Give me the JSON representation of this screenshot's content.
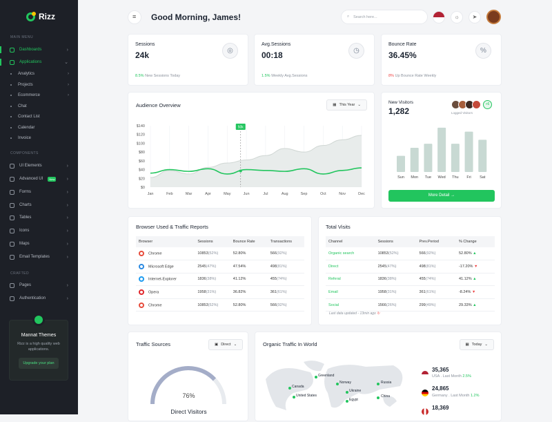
{
  "brand": {
    "name": "Rizz"
  },
  "sidebar": {
    "main_menu": "MAIN MENU",
    "dashboards": "Dashboards",
    "applications": "Applications",
    "app_items": [
      "Analytics",
      "Projects",
      "Ecommerce",
      "Chat",
      "Contact List",
      "Calendar",
      "Invoice"
    ],
    "components": "COMPONENTS",
    "comp_items": [
      "UI Elements",
      "Advanced UI",
      "Forms",
      "Charts",
      "Tables",
      "Icons",
      "Maps",
      "Email Templates"
    ],
    "new_badge": "New",
    "crafted": "CRAFTED",
    "crafted_items": [
      "Pages",
      "Authentication"
    ],
    "promo": {
      "title": "Mannat Themes",
      "text": "Rizz is a high quality web applications.",
      "button": "Upgrade your plan"
    }
  },
  "header": {
    "greeting": "Good Morning, James!",
    "search_placeholder": "Search here..."
  },
  "stats": [
    {
      "label": "Sessions",
      "value": "24k",
      "sub_value": "8.5%",
      "sub_text": "New Sessions Today",
      "sub_color": "#22c55e",
      "icon": "globe-icon"
    },
    {
      "label": "Avg.Sessions",
      "value": "00:18",
      "sub_value": "1.5%",
      "sub_text": "Weekly Avg.Sessions",
      "sub_color": "#22c55e",
      "icon": "clock-icon"
    },
    {
      "label": "Bounce Rate",
      "value": "36.45%",
      "sub_value": "8%",
      "sub_text": "Up Bounce Rate Weekly",
      "sub_color": "#ef4444",
      "icon": "percent-icon"
    }
  ],
  "audience": {
    "title": "Audience Overview",
    "filter": "This Year"
  },
  "chart_data": [
    {
      "type": "area",
      "title": "Audience Overview",
      "categories": [
        "Jan",
        "Feb",
        "Mar",
        "Apr",
        "May",
        "Jun",
        "Jul",
        "Aug",
        "Sep",
        "Oct",
        "Nov",
        "Dec"
      ],
      "y_ticks": [
        "$140",
        "$120",
        "$100",
        "$80",
        "$60",
        "$40",
        "$20",
        "$0"
      ],
      "ylim": [
        0,
        140
      ],
      "annotation": "50k",
      "series": [
        {
          "values": [
            22,
            38,
            30,
            45,
            55,
            62,
            72,
            88,
            80,
            95,
            108,
            118
          ]
        },
        {
          "values": [
            32,
            40,
            36,
            42,
            30,
            40,
            38,
            36,
            42,
            30,
            38,
            44
          ]
        }
      ],
      "grid": true
    },
    {
      "type": "bar",
      "title": "New Visitors",
      "categories": [
        "Sun",
        "Mon",
        "Tue",
        "Wed",
        "Thu",
        "Fri",
        "Sat"
      ],
      "values": [
        4,
        6,
        7,
        11,
        7,
        10,
        8
      ]
    }
  ],
  "visitors": {
    "title": "New Visitors",
    "value": "1,282",
    "logged": "Logged Visitors",
    "more": "+6",
    "button": "More Detail →"
  },
  "browser": {
    "title": "Browser Used & Traffic Reports",
    "headers": [
      "Browser",
      "Sessions",
      "Bounce Rate",
      "Transactions"
    ],
    "rows": [
      {
        "name": "Chrome",
        "sessions": "10853",
        "s_pct": "(52%)",
        "bounce": "52.80%",
        "tx": "566",
        "tx_pct": "(92%)",
        "color": "#e74c3c"
      },
      {
        "name": "Microsoft Edge",
        "sessions": "2545",
        "s_pct": "(47%)",
        "bounce": "47.54%",
        "tx": "498",
        "tx_pct": "(81%)",
        "color": "#2b8ae2"
      },
      {
        "name": "Internet-Explorer",
        "sessions": "1836",
        "s_pct": "(38%)",
        "bounce": "41.12%",
        "tx": "455",
        "tx_pct": "(74%)",
        "color": "#1d9bf0"
      },
      {
        "name": "Opera",
        "sessions": "1958",
        "s_pct": "(31%)",
        "bounce": "36.82%",
        "tx": "361",
        "tx_pct": "(61%)",
        "color": "#e0262b"
      },
      {
        "name": "Chrome",
        "sessions": "10853",
        "s_pct": "(52%)",
        "bounce": "52.80%",
        "tx": "566",
        "tx_pct": "(92%)",
        "color": "#e74c3c"
      }
    ]
  },
  "visits": {
    "title": "Total Visits",
    "headers": [
      "Channel",
      "Sessions",
      "Prev.Period",
      "% Change"
    ],
    "rows": [
      {
        "channel": "Organic search",
        "sessions": "10853",
        "s_pct": "(52%)",
        "prev": "566",
        "p_pct": "(92%)",
        "change": "52.80%",
        "dir": "up"
      },
      {
        "channel": "Direct",
        "sessions": "2545",
        "s_pct": "(47%)",
        "prev": "498",
        "p_pct": "(81%)",
        "change": "-17.20%",
        "dir": "down"
      },
      {
        "channel": "Referal",
        "sessions": "1836",
        "s_pct": "(38%)",
        "prev": "455",
        "p_pct": "(74%)",
        "change": "41.12%",
        "dir": "up"
      },
      {
        "channel": "Email",
        "sessions": "1958",
        "s_pct": "(31%)",
        "prev": "361",
        "p_pct": "(61%)",
        "change": "-8.24%",
        "dir": "down"
      },
      {
        "channel": "Social",
        "sessions": "1566",
        "s_pct": "(26%)",
        "prev": "299",
        "p_pct": "(49%)",
        "change": "29.33%",
        "dir": "up"
      }
    ],
    "footer": "Last data updated - 13min ago"
  },
  "sources": {
    "title": "Traffic Sources",
    "filter": "Direct",
    "percent": "76%",
    "label": "Direct Visitors",
    "percent_value": 0.76
  },
  "organic": {
    "title": "Organic Traffic In World",
    "filter": "Today",
    "places": [
      "Greenland",
      "Canada",
      "Norway",
      "Russia",
      "Ukraine",
      "United States",
      "Egypt",
      "China"
    ],
    "countries": [
      {
        "value": "35,365",
        "name": "USA . Last Month",
        "pct": "2.5%",
        "color": "#3b5bdb"
      },
      {
        "value": "24,865",
        "name": "Germany . Last Month",
        "pct": "1.2%",
        "color": "#e8590c"
      },
      {
        "value": "18,369",
        "name": "",
        "pct": "",
        "color": "#c92a2a"
      }
    ]
  }
}
